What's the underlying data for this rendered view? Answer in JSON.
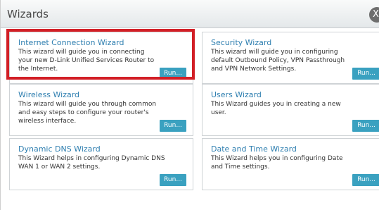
{
  "dialog": {
    "title": "Wizards",
    "close_label": "X"
  },
  "wizards": [
    {
      "title": "Internet Connection Wizard",
      "description": "This wizard will guide you in connecting\nyour new D-Link Unified Services Router to\nthe Internet.",
      "run_label": "Run..."
    },
    {
      "title": "Security Wizard",
      "description": "This wizard will guide you in configuring\ndefault Outbound Policy, VPN Passthrough\nand VPN Network Settings.",
      "run_label": "Run..."
    },
    {
      "title": "Wireless Wizard",
      "description": "This wizard will guide you through common\nand easy steps to configure your router's\nwireless interface.",
      "run_label": "Run..."
    },
    {
      "title": "Users Wizard",
      "description": "This Wizard guides you in creating a new\nuser.",
      "run_label": "Run..."
    },
    {
      "title": "Dynamic DNS Wizard",
      "description": "This Wizard helps in configuring Dynamic DNS\nWAN 1 or WAN 2 settings.",
      "run_label": "Run..."
    },
    {
      "title": "Date and Time Wizard",
      "description": "This Wizard helps you in configuring Date\nand Time settings.",
      "run_label": "Run..."
    }
  ],
  "colors": {
    "accent": "#3aa1c0",
    "title_text": "#2f7fb0",
    "highlight": "#d21f26"
  }
}
